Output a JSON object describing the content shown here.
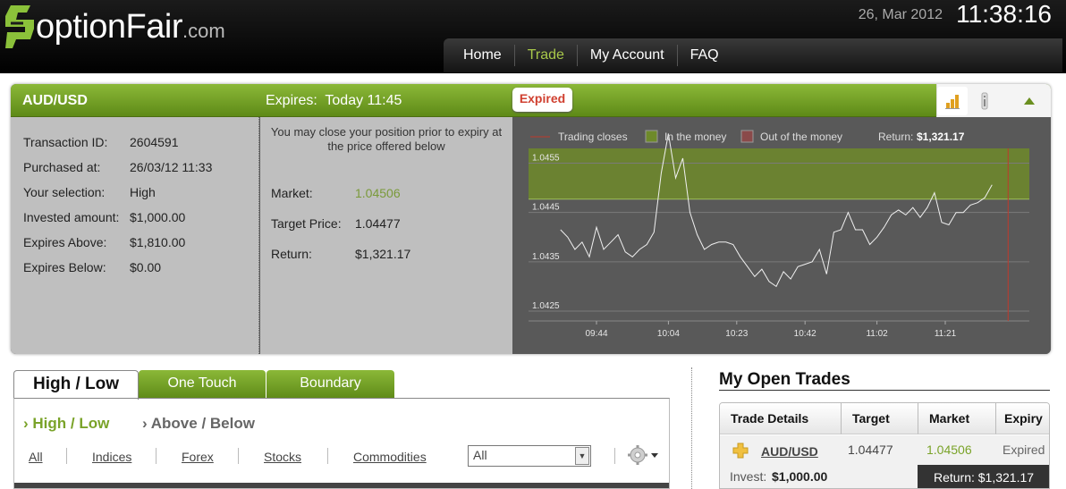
{
  "header": {
    "logo_text": "optionFair",
    "logo_suffix": ".com",
    "date": "26, Mar 2012",
    "time": "11:38:16",
    "nav": [
      "Home",
      "Trade",
      "My Account",
      "FAQ"
    ],
    "nav_active": "Trade",
    "colors": {
      "accent": "#a8c84a",
      "brand_green": "#6a9a1f"
    }
  },
  "trade": {
    "pair": "AUD/USD",
    "expires_label": "Expires:",
    "expires_value": "Today 11:45",
    "status": "Expired",
    "details": [
      {
        "label": "Transaction ID:",
        "value": "2604591"
      },
      {
        "label": "Purchased at:",
        "value": "26/03/12 11:33"
      },
      {
        "label": "Your selection:",
        "value": "High"
      },
      {
        "label": "Invested amount:",
        "value": "$1,000.00"
      },
      {
        "label": "Expires Above:",
        "value": "$1,810.00"
      },
      {
        "label": "Expires Below:",
        "value": "$0.00"
      }
    ],
    "close_note": "You may close your position prior to expiry at the price offered below",
    "market_label": "Market:",
    "market_value": "1.04506",
    "target_label": "Target Price:",
    "target_value": "1.04477",
    "return_label": "Return:",
    "return_value": "$1,321.17",
    "icons": [
      "bar-chart-icon",
      "info-icon",
      "collapse-up-icon"
    ]
  },
  "chart_data": {
    "type": "line",
    "legend": [
      {
        "label": "Trading closes",
        "color": "#c0392b"
      },
      {
        "label": "In the money",
        "color": "#6e8a2a"
      },
      {
        "label": "Out of the money",
        "color": "#8a4a4a"
      }
    ],
    "return_label": "Return:",
    "return_value": "$1,321.17",
    "x_ticks": [
      "09:44",
      "10:04",
      "10:23",
      "10:42",
      "11:02",
      "11:21"
    ],
    "y_ticks": [
      "1.0455",
      "1.0445",
      "1.0435",
      "1.0425"
    ],
    "ylim": [
      1.0423,
      1.0458
    ],
    "target": 1.04477,
    "in_the_money_range": [
      1.04477,
      1.0458
    ],
    "x": [
      "09:34",
      "09:36",
      "09:38",
      "09:40",
      "09:42",
      "09:44",
      "09:46",
      "09:48",
      "09:50",
      "09:52",
      "09:54",
      "09:56",
      "09:58",
      "10:00",
      "10:02",
      "10:04",
      "10:06",
      "10:08",
      "10:10",
      "10:12",
      "10:14",
      "10:16",
      "10:18",
      "10:20",
      "10:22",
      "10:24",
      "10:26",
      "10:28",
      "10:30",
      "10:32",
      "10:34",
      "10:36",
      "10:38",
      "10:40",
      "10:42",
      "10:44",
      "10:46",
      "10:48",
      "10:50",
      "10:52",
      "10:54",
      "10:56",
      "10:58",
      "11:00",
      "11:02",
      "11:04",
      "11:06",
      "11:08",
      "11:10",
      "11:12",
      "11:14",
      "11:16",
      "11:18",
      "11:20",
      "11:22",
      "11:24",
      "11:26",
      "11:28",
      "11:30",
      "11:32",
      "11:34"
    ],
    "values": [
      1.04415,
      1.044,
      1.04375,
      1.0439,
      1.0436,
      1.0442,
      1.04375,
      1.0439,
      1.04405,
      1.0437,
      1.0436,
      1.04375,
      1.04385,
      1.0441,
      1.0453,
      1.0461,
      1.0452,
      1.0456,
      1.0445,
      1.04405,
      1.04375,
      1.04385,
      1.0439,
      1.0439,
      1.04385,
      1.0436,
      1.0434,
      1.0432,
      1.04335,
      1.0431,
      1.043,
      1.0433,
      1.04315,
      1.0434,
      1.04345,
      1.0435,
      1.04375,
      1.04325,
      1.0441,
      1.04415,
      1.0445,
      1.04415,
      1.04415,
      1.04385,
      1.044,
      1.0442,
      1.04445,
      1.04455,
      1.04445,
      1.0446,
      1.0444,
      1.0446,
      1.0449,
      1.0443,
      1.04425,
      1.0445,
      1.0445,
      1.04465,
      1.0447,
      1.0448,
      1.04506
    ],
    "closes_at": "11:34"
  },
  "lower": {
    "tabs": [
      "High / Low",
      "One Touch",
      "Boundary"
    ],
    "sub_tabs": [
      "High / Low",
      "Above / Below"
    ],
    "filters": [
      "All",
      "Indices",
      "Forex",
      "Stocks",
      "Commodities"
    ],
    "select_value": "All"
  },
  "open_trades": {
    "title": "My Open Trades",
    "headers": [
      "Trade Details",
      "Target",
      "Market",
      "Expiry"
    ],
    "row": {
      "pair": "AUD/USD",
      "target": "1.04477",
      "market": "1.04506",
      "expiry": "Expired",
      "invest_label": "Invest:",
      "invest_value": "$1,000.00",
      "return_text": "Return: $1,321.17"
    }
  }
}
